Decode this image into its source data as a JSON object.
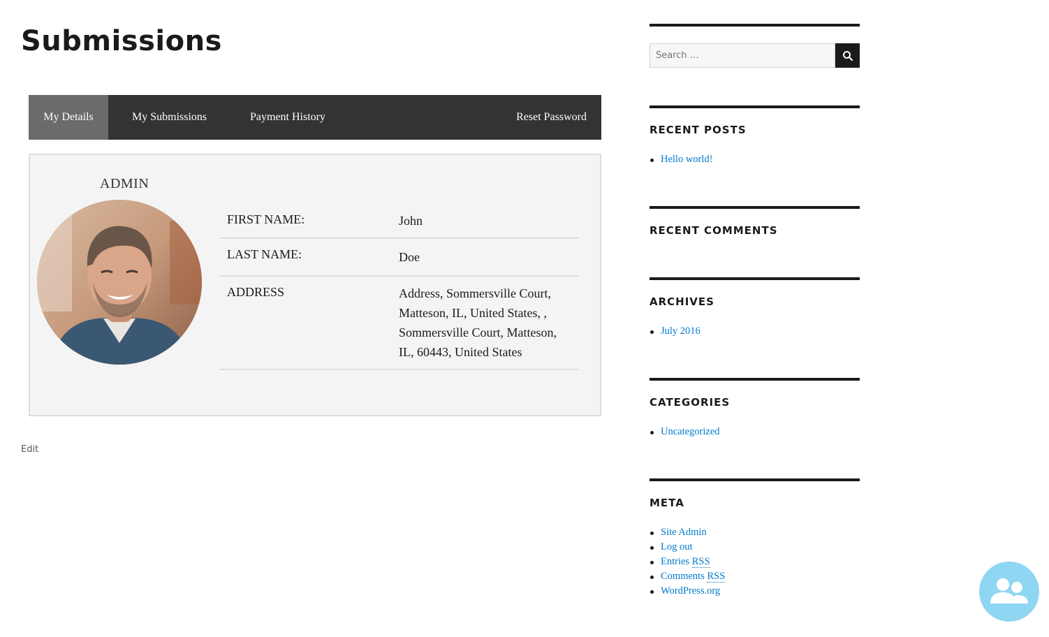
{
  "page": {
    "title": "Submissions"
  },
  "tabs": [
    {
      "label": "My Details",
      "active": true
    },
    {
      "label": "My Submissions",
      "active": false
    },
    {
      "label": "Payment History",
      "active": false
    },
    {
      "label": "Reset Password",
      "active": false
    }
  ],
  "profile": {
    "username": "ADMIN",
    "avatar_icon": "user-photo-avatar",
    "fields": [
      {
        "label": "FIRST NAME:",
        "value": "John"
      },
      {
        "label": "LAST NAME:",
        "value": "Doe"
      },
      {
        "label": "ADDRESS",
        "value": "Address, Sommersville Court, Matteson, IL, United States, , Sommersville Court, Matteson, IL, 60443, United States"
      }
    ]
  },
  "edit_link": "Edit",
  "sidebar": {
    "search": {
      "placeholder": "Search …",
      "button_icon": "search-icon"
    },
    "recent_posts": {
      "title": "RECENT POSTS",
      "items": [
        "Hello world!"
      ]
    },
    "recent_comments": {
      "title": "RECENT COMMENTS",
      "items": []
    },
    "archives": {
      "title": "ARCHIVES",
      "items": [
        "July 2016"
      ]
    },
    "categories": {
      "title": "CATEGORIES",
      "items": [
        "Uncategorized"
      ]
    },
    "meta": {
      "title": "META",
      "items": [
        "Site Admin",
        "Log out",
        "Entries",
        "Comments",
        "WordPress.org"
      ],
      "rss_abbr": "RSS"
    }
  },
  "fab": {
    "icon": "users-icon"
  },
  "colors": {
    "tab_bar": "#333333",
    "tab_active": "#6b6b6b",
    "link": "#007acc",
    "card_bg": "#f4f4f4",
    "fab": "#8fd6f2"
  }
}
